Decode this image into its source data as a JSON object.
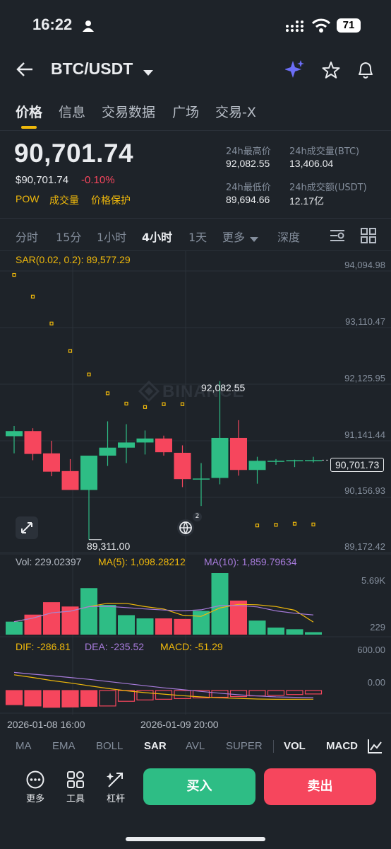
{
  "status": {
    "time": "16:22",
    "battery": "71"
  },
  "header": {
    "pair": "BTC/USDT"
  },
  "tabs": [
    "价格",
    "信息",
    "交易数据",
    "广场",
    "交易-X"
  ],
  "price": {
    "last": "90,701.74",
    "usd": "$90,701.74",
    "change": "-0.10%",
    "tags": [
      "POW",
      "成交量",
      "价格保护"
    ]
  },
  "stats": {
    "high_label": "24h最高价",
    "high": "92,082.55",
    "vol_btc_label": "24h成交量(BTC)",
    "vol_btc": "13,406.04",
    "low_label": "24h最低价",
    "low": "89,694.66",
    "vol_usdt_label": "24h成交额(USDT)",
    "vol_usdt": "12.17亿"
  },
  "intervals": [
    "分时",
    "15分",
    "1小时",
    "4小时",
    "1天",
    "更多",
    "深度"
  ],
  "selected_interval": "4小时",
  "chart": {
    "sar_label": "SAR(0.02, 0.2): 89,577.29",
    "y_labels": [
      "94,094.98",
      "93,110.47",
      "92,125.95",
      "91,141.44",
      "90,156.93",
      "89,172.42"
    ],
    "current_price": "90,701.73",
    "high_marker": "92,082.55",
    "low_marker": "89,311.00",
    "watermark": "BINANCE",
    "globe_badge": "2"
  },
  "volume": {
    "vol_label": "Vol: 229.02397",
    "ma5_label": "MA(5): 1,098.28212",
    "ma10_label": "MA(10): 1,859.79634",
    "y_top": "5.69K",
    "y_bottom": "229"
  },
  "macd": {
    "dif_label": "DIF: -286.81",
    "dea_label": "DEA: -235.52",
    "macd_label": "MACD: -51.29",
    "y_top": "600.00",
    "y_mid": "0.00"
  },
  "time_labels": [
    "2026-01-08 16:00",
    "2026-01-09 20:00"
  ],
  "indicators": [
    "MA",
    "EMA",
    "BOLL",
    "SAR",
    "AVL",
    "SUPER",
    "VOL",
    "MACD"
  ],
  "toolbar": {
    "more": "更多",
    "tools": "工具",
    "leverage": "杠杆"
  },
  "buy_label": "买入",
  "sell_label": "卖出",
  "colors": {
    "up": "#2ebd85",
    "down": "#f6465d",
    "accent": "#f0b90b",
    "bg": "#1e2329"
  },
  "chart_data": {
    "type": "candlestick",
    "candles": [
      {
        "o": 91120,
        "h": 91300,
        "l": 90820,
        "c": 91210
      },
      {
        "o": 91210,
        "h": 91260,
        "l": 90700,
        "c": 90810
      },
      {
        "o": 90820,
        "h": 91040,
        "l": 90420,
        "c": 90500
      },
      {
        "o": 90510,
        "h": 90720,
        "l": 90200,
        "c": 90180
      },
      {
        "o": 90180,
        "h": 90620,
        "l": 89311,
        "c": 90780
      },
      {
        "o": 90780,
        "h": 91380,
        "l": 90600,
        "c": 90920
      },
      {
        "o": 90920,
        "h": 91330,
        "l": 90650,
        "c": 91010
      },
      {
        "o": 91010,
        "h": 91220,
        "l": 90800,
        "c": 91080
      },
      {
        "o": 91080,
        "h": 91130,
        "l": 90780,
        "c": 90840
      },
      {
        "o": 90830,
        "h": 90960,
        "l": 90230,
        "c": 90370
      },
      {
        "o": 90370,
        "h": 90650,
        "l": 89900,
        "c": 90380
      },
      {
        "o": 90390,
        "h": 92082.55,
        "l": 90280,
        "c": 91090
      },
      {
        "o": 91090,
        "h": 91400,
        "l": 90430,
        "c": 90530
      },
      {
        "o": 90530,
        "h": 90760,
        "l": 90290,
        "c": 90690
      },
      {
        "o": 90690,
        "h": 90720,
        "l": 90620,
        "c": 90690
      },
      {
        "o": 90690,
        "h": 90710,
        "l": 90580,
        "c": 90700
      },
      {
        "o": 90690,
        "h": 90760,
        "l": 90660,
        "c": 90701.73
      }
    ],
    "sar": [
      93940,
      93560,
      93090,
      92610,
      92200,
      91870,
      91690,
      91630,
      91680,
      91680,
      null,
      null,
      null,
      89560,
      89570,
      89590,
      89577.29
    ],
    "volumes": [
      1200,
      1850,
      3000,
      2600,
      4300,
      2750,
      1800,
      1500,
      1500,
      1450,
      2200,
      5690,
      3150,
      1300,
      650,
      500,
      229
    ],
    "macd_hist": [
      -210,
      -230,
      -250,
      -245,
      -235,
      -230,
      -160,
      -140,
      -130,
      -120,
      -110,
      -100,
      -90,
      -80,
      -70,
      -60,
      -51.29
    ],
    "y_range": [
      89172.42,
      94094.98
    ]
  }
}
